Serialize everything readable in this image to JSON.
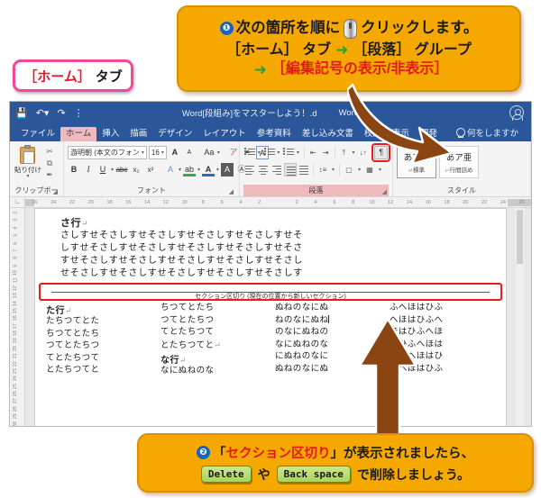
{
  "callout_top": {
    "step_number": "❶",
    "line1_a": "次の箇所を順に",
    "line1_b": "クリックします。",
    "line2_a": "［ホーム］ タブ",
    "arrow": "➜",
    "line2_b": "［段落］ グループ",
    "line3": "［編集記号の表示/非表示］"
  },
  "label_home": {
    "bracket_text": "［ホーム］",
    "tab_text": "タブ"
  },
  "word_window": {
    "title": "Word[段組み]をマスターしよう！.d",
    "title_suffix": "Word",
    "quick_access": [
      "save-icon",
      "undo-icon",
      "redo-icon",
      "more-icon"
    ],
    "account_icon": "account-icon",
    "tabs": [
      {
        "label": "ファイル",
        "active": false
      },
      {
        "label": "ホーム",
        "active": true
      },
      {
        "label": "挿入",
        "active": false
      },
      {
        "label": "描画",
        "active": false
      },
      {
        "label": "デザイン",
        "active": false
      },
      {
        "label": "レイアウト",
        "active": false
      },
      {
        "label": "参考資料",
        "active": false
      },
      {
        "label": "差し込み文書",
        "active": false
      },
      {
        "label": "校閲",
        "active": false
      },
      {
        "label": "表示",
        "active": false
      },
      {
        "label": "開発",
        "active": false
      }
    ],
    "tell_me": "何をしますか",
    "ribbon": {
      "clipboard": {
        "group_name": "クリップボード",
        "paste_label": "貼り付け",
        "cut": "✂",
        "copy": "⧉",
        "format_painter": "✒"
      },
      "font": {
        "group_name": "フォント",
        "font_name": "游明朝 (本文のフォン",
        "font_size": "16",
        "grow": "A",
        "shrink": "A",
        "case": "Aa",
        "clear_fmt": "✒",
        "phonetic": "ア",
        "char_border": "A",
        "bold": "B",
        "italic": "I",
        "underline": "U",
        "strike": "abc",
        "subscript": "x₂",
        "superscript": "x²",
        "text_effects": "A",
        "highlight": "ab",
        "font_color": "A",
        "char_shading": "A",
        "enclose": "Ⓐ"
      },
      "paragraph": {
        "group_name": "段落",
        "bullets": "bullet-list-icon",
        "numbering": "numbered-list-icon",
        "multilevel": "multilevel-list-icon",
        "dec_indent": "decrease-indent-icon",
        "inc_indent": "increase-indent-icon",
        "align_text": "align-text-icon",
        "sort": "sort-icon",
        "show_marks": "¶",
        "show_marks_title": "編集記号の表示/非表示",
        "align_left": "align-left-icon",
        "align_center": "align-center-icon",
        "align_right": "align-right-icon",
        "justify": "justify-icon",
        "distribute": "distribute-icon",
        "line_spacing": "line-spacing-icon",
        "shading": "shading-icon",
        "borders": "borders-icon"
      },
      "styles": {
        "group_name": "スタイル",
        "items": [
          {
            "sample": "あア亜",
            "name": "標準",
            "selected": true
          },
          {
            "sample": "あア亜",
            "name": "行間詰め",
            "selected": false
          }
        ]
      }
    },
    "h_ruler": [
      "26",
      "24",
      "22",
      "20",
      "18",
      "16",
      "14",
      "12",
      "10",
      "8",
      "6",
      "4",
      "2",
      "",
      "2",
      "4",
      "6",
      "8",
      "10",
      "12",
      "14",
      "16",
      "18",
      "20",
      "22",
      "24",
      "26"
    ],
    "v_ruler": [
      "2",
      "3",
      "4",
      "5",
      "6",
      "7",
      "8",
      "9",
      "10",
      "11",
      "12",
      "13",
      "14",
      "15",
      "16",
      "17",
      "18",
      "19",
      "20",
      "21",
      "22",
      "23",
      "24",
      "25",
      "26",
      "27",
      "28",
      "29",
      "30"
    ],
    "document": {
      "heading1": "さ行",
      "pilcrow": "↵",
      "sa_lines": [
        "さしすせそさしすせそさしすせそさしすせそさしすせそ",
        "しすせそさしすせそさしすせそさしすせそさしすせそさ",
        "すせそさしすせそさしすせそさしすせそさしすせそさし",
        "せそさしすせそさしすせそさしすせそさしすせそさしす"
      ],
      "section_break_label": "セクション区切り (現在の位置から新しいセクション)",
      "columns": [
        {
          "heading": "た行",
          "lines": [
            "たちつてとた",
            "ちつてとたち",
            "つてとたちつ",
            "てとたちつて",
            "とたちつてと"
          ]
        },
        {
          "heading": "",
          "lines": [
            "ちつてとたち",
            "つてとたちつ",
            "てとたちつて",
            "とたちつてと",
            "な行",
            "なにぬねのな"
          ]
        },
        {
          "heading": "",
          "lines": [
            "ぬねのなにぬ",
            "ねのなにぬね",
            "のなにぬねの",
            "なにぬねのな",
            "にぬねのなに",
            "ぬねのなにぬ"
          ]
        },
        {
          "heading": "",
          "lines": [
            "ふへほはひふ",
            "へほはひふへ",
            "ほはひふへほ",
            "はひふへほは",
            "ひふへほはひ",
            "ふへほはひふ"
          ]
        }
      ]
    }
  },
  "callout_bottom": {
    "step_number": "❷",
    "line1_a": "「",
    "line1_red": "セクション区切り",
    "line1_b": "」が表示されましたら、",
    "key_delete": "Delete",
    "conj": "や",
    "key_backspace": "Back space",
    "line2_tail": "で削除しましょう。"
  },
  "colors": {
    "callout_bg": "#f5a800",
    "callout_border": "#d99000",
    "red_accent": "#e01b1b",
    "pink_border": "#f3479c",
    "word_blue": "#2b579a",
    "arrow_brown": "#8a4513",
    "key_green": "#a8d45e"
  }
}
